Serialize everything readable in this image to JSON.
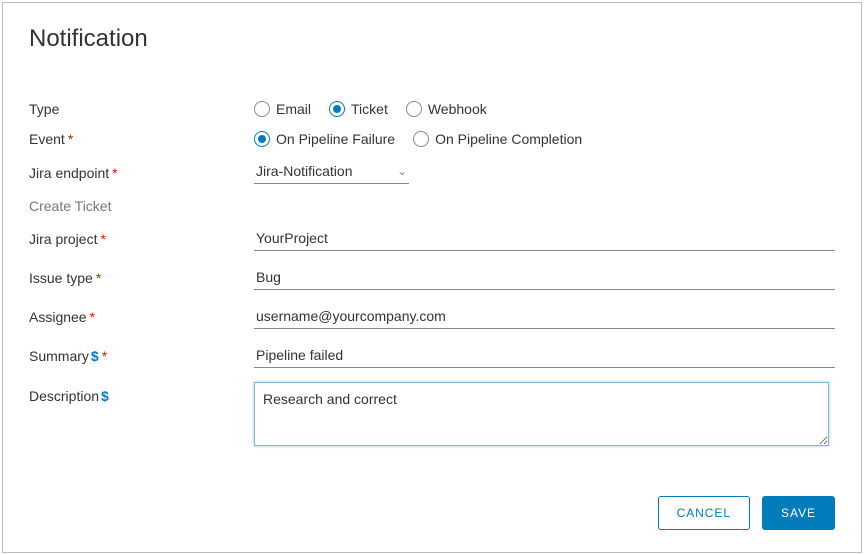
{
  "title": "Notification",
  "labels": {
    "type": "Type",
    "event": "Event",
    "jira_endpoint": "Jira endpoint",
    "create_ticket": "Create Ticket",
    "jira_project": "Jira project",
    "issue_type": "Issue type",
    "assignee": "Assignee",
    "summary": "Summary",
    "description": "Description"
  },
  "type": {
    "options": {
      "email": "Email",
      "ticket": "Ticket",
      "webhook": "Webhook"
    },
    "selected": "ticket"
  },
  "event": {
    "options": {
      "failure": "On Pipeline Failure",
      "completion": "On Pipeline Completion"
    },
    "selected": "failure"
  },
  "jira_endpoint": {
    "value": "Jira-Notification"
  },
  "jira_project": {
    "value": "YourProject"
  },
  "issue_type": {
    "value": "Bug"
  },
  "assignee": {
    "value": "username@yourcompany.com"
  },
  "summary": {
    "value": "Pipeline failed"
  },
  "description": {
    "value": "Research and correct"
  },
  "buttons": {
    "cancel": "Cancel",
    "save": "Save"
  },
  "symbols": {
    "required": "*",
    "variable": "$"
  }
}
